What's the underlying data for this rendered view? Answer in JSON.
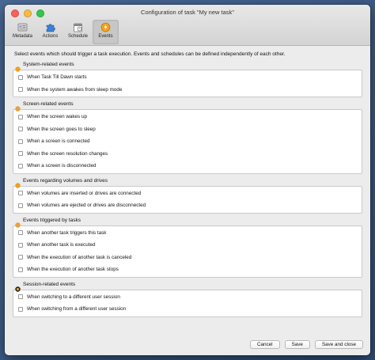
{
  "window": {
    "title": "Configuration of task \"My new task\""
  },
  "toolbar": {
    "items": [
      {
        "label": "Metadata",
        "icon": "metadata-icon"
      },
      {
        "label": "Actions",
        "icon": "puzzle-icon"
      },
      {
        "label": "Schedule",
        "icon": "calendar-icon"
      },
      {
        "label": "Events",
        "icon": "events-icon",
        "selected": true
      }
    ]
  },
  "intro": "Select events which should trigger a task execution. Events and schedules can be defined independently of each other.",
  "sections": [
    {
      "title": "System-related events",
      "icon": "system-icon",
      "items": [
        "When Task Till Dawn starts",
        "When the system awakes from sleep mode"
      ]
    },
    {
      "title": "Screen-related events",
      "icon": "screen-icon",
      "items": [
        "When the screen wakes up",
        "When the screen goes to sleep",
        "When a screen is connected",
        "When the screen resolution changes",
        "When a screen is disconnected"
      ]
    },
    {
      "title": "Events regarding volumes and drives",
      "icon": "drive-icon",
      "items": [
        "When volumes are inserted or drives are connected",
        "When volumes are ejected or drives are disconnected"
      ]
    },
    {
      "title": "Events triggered by tasks",
      "icon": "task-icon",
      "items": [
        "When another task triggers this task",
        "When another task is executed",
        "When the execution of another task is canceled",
        "When the execution of another task stops"
      ]
    },
    {
      "title": "Session-related events",
      "icon": "session-icon",
      "items": [
        "When switching to a different user session",
        "When switching from a different user session"
      ]
    }
  ],
  "buttons": {
    "cancel": "Cancel",
    "save": "Save",
    "save_close": "Save and close"
  },
  "colors": {
    "accent_orange": "#f0a020",
    "selected_tab": "#c7c7c7"
  }
}
